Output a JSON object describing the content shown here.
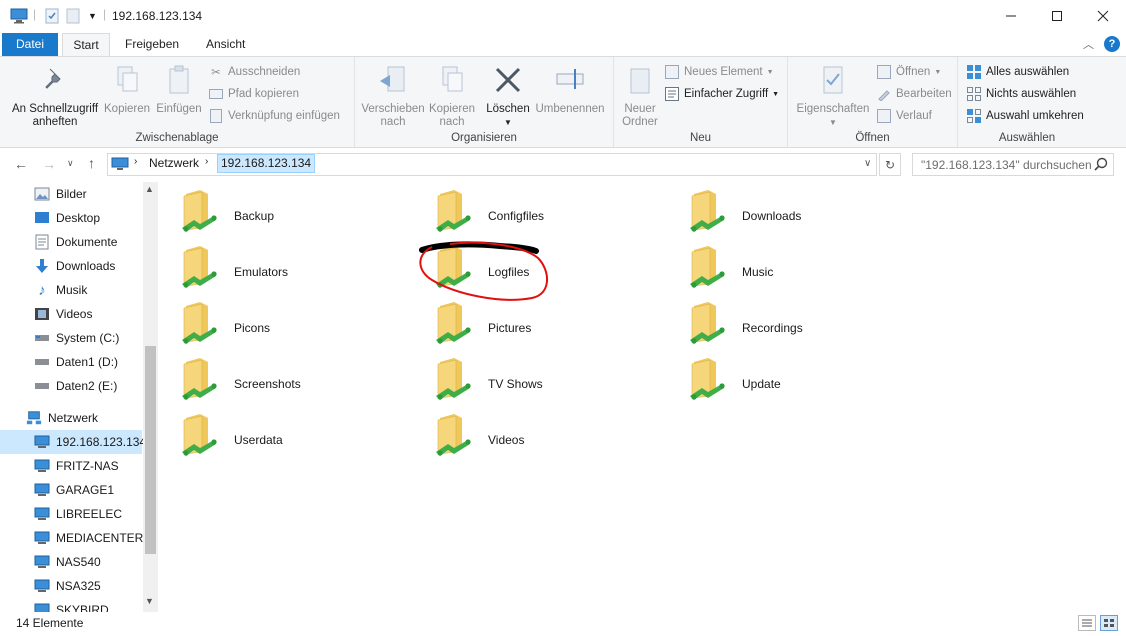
{
  "window": {
    "title": "192.168.123.134",
    "controls": [
      "minimize-icon",
      "maximize-icon",
      "close-icon"
    ]
  },
  "ribbon_tabs": {
    "datei": "Datei",
    "start": "Start",
    "freigeben": "Freigeben",
    "ansicht": "Ansicht"
  },
  "ribbon": {
    "zwischenablage": {
      "label": "Zwischenablage",
      "pin_line1": "An Schnellzugriff",
      "pin_line2": "anheften",
      "kopieren": "Kopieren",
      "einfuegen": "Einfügen",
      "ausschneiden": "Ausschneiden",
      "pfad_kopieren": "Pfad kopieren",
      "verknuepfung": "Verknüpfung einfügen"
    },
    "organisieren": {
      "label": "Organisieren",
      "verschieben_line1": "Verschieben",
      "verschieben_line2": "nach",
      "kopieren_line1": "Kopieren",
      "kopieren_line2": "nach",
      "loeschen": "Löschen",
      "umbenennen": "Umbenennen"
    },
    "neu": {
      "label": "Neu",
      "ordner_line1": "Neuer",
      "ordner_line2": "Ordner",
      "neues_element": "Neues Element",
      "einfacher_zugriff": "Einfacher Zugriff"
    },
    "oeffnen": {
      "label": "Öffnen",
      "eigenschaften": "Eigenschaften",
      "oeffnen": "Öffnen",
      "bearbeiten": "Bearbeiten",
      "verlauf": "Verlauf"
    },
    "auswaehlen": {
      "label": "Auswählen",
      "alles": "Alles auswählen",
      "nichts": "Nichts auswählen",
      "umkehren": "Auswahl umkehren"
    }
  },
  "address": {
    "crumb_root": "Netzwerk",
    "crumb_current": "192.168.123.134",
    "search_placeholder": "\"192.168.123.134\" durchsuchen"
  },
  "sidebar": {
    "items": [
      {
        "label": "Bilder",
        "icon": "pictures-icon"
      },
      {
        "label": "Desktop",
        "icon": "desktop-icon"
      },
      {
        "label": "Dokumente",
        "icon": "documents-icon"
      },
      {
        "label": "Downloads",
        "icon": "downloads-icon"
      },
      {
        "label": "Musik",
        "icon": "music-icon"
      },
      {
        "label": "Videos",
        "icon": "videos-icon"
      },
      {
        "label": "System (C:)",
        "icon": "drive-icon"
      },
      {
        "label": "Daten1 (D:)",
        "icon": "drive-icon"
      },
      {
        "label": "Daten2 (E:)",
        "icon": "drive-icon"
      },
      {
        "label": "Netzwerk",
        "icon": "network-icon"
      },
      {
        "label": "192.168.123.134",
        "icon": "computer-icon",
        "selected": true
      },
      {
        "label": "FRITZ-NAS",
        "icon": "computer-icon"
      },
      {
        "label": "GARAGE1",
        "icon": "computer-icon"
      },
      {
        "label": "LIBREELEC",
        "icon": "computer-icon"
      },
      {
        "label": "MEDIACENTER",
        "icon": "computer-icon"
      },
      {
        "label": "NAS540",
        "icon": "computer-icon"
      },
      {
        "label": "NSA325",
        "icon": "computer-icon"
      },
      {
        "label": "SKYBIRD",
        "icon": "computer-icon"
      }
    ]
  },
  "folders": [
    {
      "name": "Backup"
    },
    {
      "name": "Configfiles"
    },
    {
      "name": "Downloads"
    },
    {
      "name": "Emulators"
    },
    {
      "name": "Logfiles"
    },
    {
      "name": "Music"
    },
    {
      "name": "Picons"
    },
    {
      "name": "Pictures"
    },
    {
      "name": "Recordings"
    },
    {
      "name": "Screenshots"
    },
    {
      "name": "TV Shows"
    },
    {
      "name": "Update"
    },
    {
      "name": "Userdata"
    },
    {
      "name": "Videos"
    }
  ],
  "status": {
    "count": "14 Elemente"
  },
  "colors": {
    "accent": "#1979ca",
    "selection": "#cce8ff",
    "annotation_red": "#e01010",
    "folder_yellow": "#f6d67a",
    "share_green": "#3fae49"
  }
}
